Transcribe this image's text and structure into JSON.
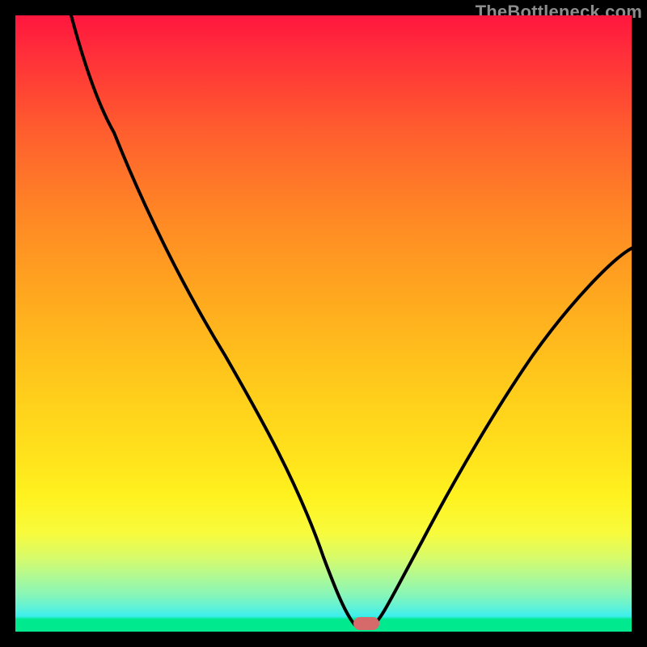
{
  "watermark": "TheBottleneck.com",
  "chart_data": {
    "type": "line",
    "title": "",
    "xlabel": "",
    "ylabel": "",
    "xlim": [
      0,
      100
    ],
    "ylim": [
      0,
      100
    ],
    "grid": false,
    "legend": false,
    "curve_comment": "V-shaped bottleneck curve. x is horizontal 0..100 (left to right), y is vertical value 0..100 (0 at bottom, 100 at top).",
    "x": [
      9,
      12,
      16,
      22,
      28,
      34,
      40,
      46,
      50,
      54,
      56,
      58,
      60,
      66,
      74,
      82,
      90,
      100
    ],
    "y": [
      100,
      92,
      81,
      68,
      56,
      45,
      34,
      22,
      12,
      4,
      0,
      0,
      1,
      10,
      24,
      38,
      50,
      62
    ],
    "marker": {
      "x": 57,
      "y": 0,
      "color": "#d66a6a"
    },
    "background_gradient_comment": "Vertical gradient: red (top) → orange → yellow → green (bottom).",
    "colors": {
      "curve": "#000000",
      "marker": "#d66a6a",
      "frame": "#000000"
    }
  }
}
